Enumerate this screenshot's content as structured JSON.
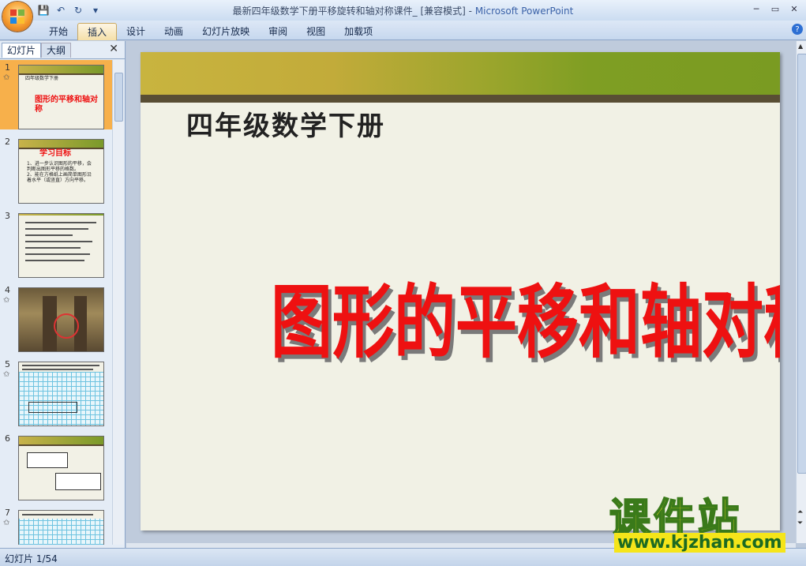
{
  "window": {
    "title_doc": "最新四年级数学下册平移旋转和轴对称课件_ [兼容模式]",
    "title_sep": " - ",
    "title_app": "Microsoft PowerPoint"
  },
  "ribbon": {
    "tabs": [
      "开始",
      "插入",
      "设计",
      "动画",
      "幻灯片放映",
      "审阅",
      "视图",
      "加载项"
    ],
    "active_tab": "插入"
  },
  "panel": {
    "tab_slides": "幻灯片",
    "tab_outline": "大纲",
    "thumbnails": [
      {
        "num": "1",
        "title": "四年级数学下册",
        "main": "图形的平移和轴对称"
      },
      {
        "num": "2",
        "title": "学习目标",
        "lines": [
          "1、进一步认识图形的平移，会",
          "判断出图形平移的格数。",
          "2、能在方格纸上画简单图形沿",
          "着水平（或竖直）方向平移。"
        ]
      },
      {
        "num": "3"
      },
      {
        "num": "4"
      },
      {
        "num": "5"
      },
      {
        "num": "6"
      },
      {
        "num": "7"
      }
    ]
  },
  "slide": {
    "subtitle": "四年级数学下册",
    "title": "图形的平移和轴对称"
  },
  "status": {
    "slide_counter": "幻灯片 1/54"
  },
  "watermark": {
    "brand": "课件站",
    "url": "www.kjzhan.com"
  },
  "colors": {
    "title_red": "#ee1111",
    "band_green": "#7a9b22",
    "band_gold": "#c8b43f",
    "selected_thumb": "#f7b04b"
  }
}
